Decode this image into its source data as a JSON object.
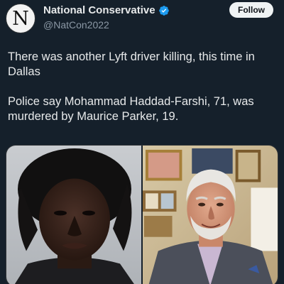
{
  "account": {
    "display_name": "National Conservative",
    "handle": "@NatCon2022",
    "avatar_letter": "N",
    "verified": true,
    "verified_color": "#1d9bf0"
  },
  "follow_button": {
    "label": "Follow"
  },
  "tweet": {
    "paragraphs": [
      "There was another Lyft driver killing, this time in Dallas",
      "Police say Mohammad Haddad-Farshi, 71, was murdered by Maurice Parker, 19."
    ]
  },
  "media": [
    {
      "kind": "photo",
      "subject": "mugshot"
    },
    {
      "kind": "photo",
      "subject": "portrait"
    }
  ],
  "colors": {
    "background": "#15202b",
    "text": "#e7e9ea",
    "secondary_text": "#8b98a5",
    "follow_button_bg": "#eff3f4"
  }
}
